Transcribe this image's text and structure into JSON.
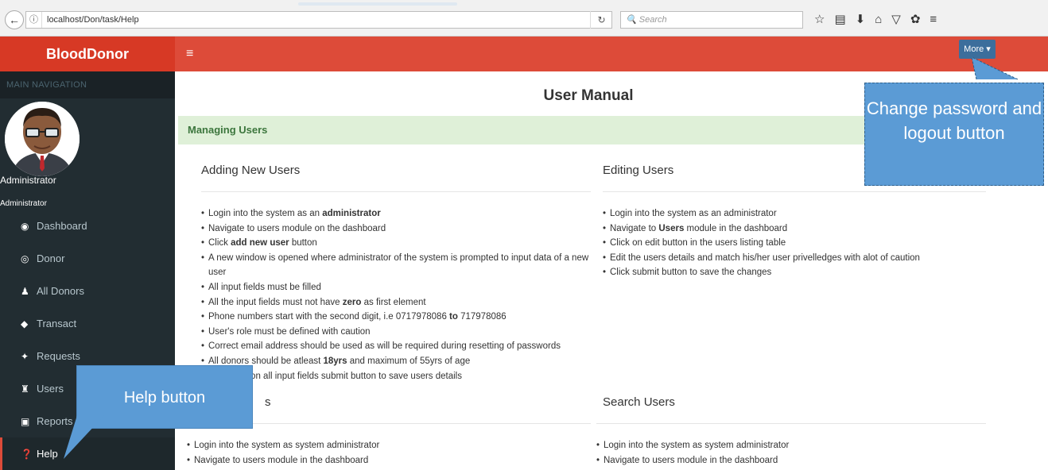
{
  "browser": {
    "url": "localhost/Don/task/Help",
    "search_placeholder": "Search"
  },
  "header": {
    "brand": "BloodDonor",
    "more_label": "More ▾"
  },
  "sidebar": {
    "nav_header": "MAIN NAVIGATION",
    "user_name": "Administrator",
    "user_role": "Administrator",
    "items": [
      {
        "label": "Dashboard",
        "icon": "dashboard-icon"
      },
      {
        "label": "Donor",
        "icon": "globe-icon"
      },
      {
        "label": "All Donors",
        "icon": "user-icon"
      },
      {
        "label": "Transact",
        "icon": "tag-icon"
      },
      {
        "label": "Requests",
        "icon": "pin-icon"
      },
      {
        "label": "Users",
        "icon": "users-icon"
      },
      {
        "label": "Reports",
        "icon": "reports-icon"
      },
      {
        "label": "Help",
        "icon": "help-icon",
        "active": true
      }
    ]
  },
  "main": {
    "title": "User Manual",
    "section": "Managing Users",
    "adding": {
      "heading": "Adding New Users",
      "items": [
        [
          "Login into the system as an ",
          "administrator",
          ""
        ],
        [
          "Navigate to users module on the dashboard",
          "",
          ""
        ],
        [
          "Click ",
          "add new user",
          " button"
        ],
        [
          "A new window is opened where administrator of the system is prompted to input data of a new user",
          "",
          ""
        ],
        [
          "All input fields must be filled",
          "",
          ""
        ],
        [
          "All the input fields must not have ",
          "zero",
          " as first element"
        ],
        [
          "Phone numbers start with the second digit, i.e 0717978086 ",
          "to",
          " 717978086"
        ],
        [
          "User's role must be defined with caution",
          "",
          ""
        ],
        [
          "Correct email address should be used as will be required during resetting of passwords",
          "",
          ""
        ],
        [
          "All donors should be atleast ",
          "18yrs",
          " and maximum of 55yrs of age"
        ],
        [
          "After data on all input fields submit button to save users details",
          "",
          ""
        ]
      ]
    },
    "editing": {
      "heading": "Editing Users",
      "items": [
        [
          "Login into the system as an administrator",
          "",
          ""
        ],
        [
          "Navigate to ",
          "Users",
          " module in the dashboard"
        ],
        [
          "Click on edit button in the users listing table",
          "",
          ""
        ],
        [
          "Edit the users details and match his/her user privelledges with alot of caution",
          "",
          ""
        ],
        [
          "Click submit button to save the changes",
          "",
          ""
        ]
      ]
    },
    "deleting": {
      "heading": "s",
      "items": [
        [
          "Login into the system as system administrator",
          "",
          ""
        ],
        [
          "Navigate to users module in the dashboard",
          "",
          ""
        ]
      ]
    },
    "search": {
      "heading": "Search Users",
      "items": [
        [
          "Login into the system as system administrator",
          "",
          ""
        ],
        [
          "Navigate to users module in the dashboard",
          "",
          ""
        ]
      ]
    }
  },
  "callouts": {
    "right": "Change password and logout button",
    "left": "Help button"
  },
  "colors": {
    "header": "#dd4b39",
    "sidebar": "#222d32",
    "section": "#dff0d8",
    "callout": "#5b9bd5"
  }
}
